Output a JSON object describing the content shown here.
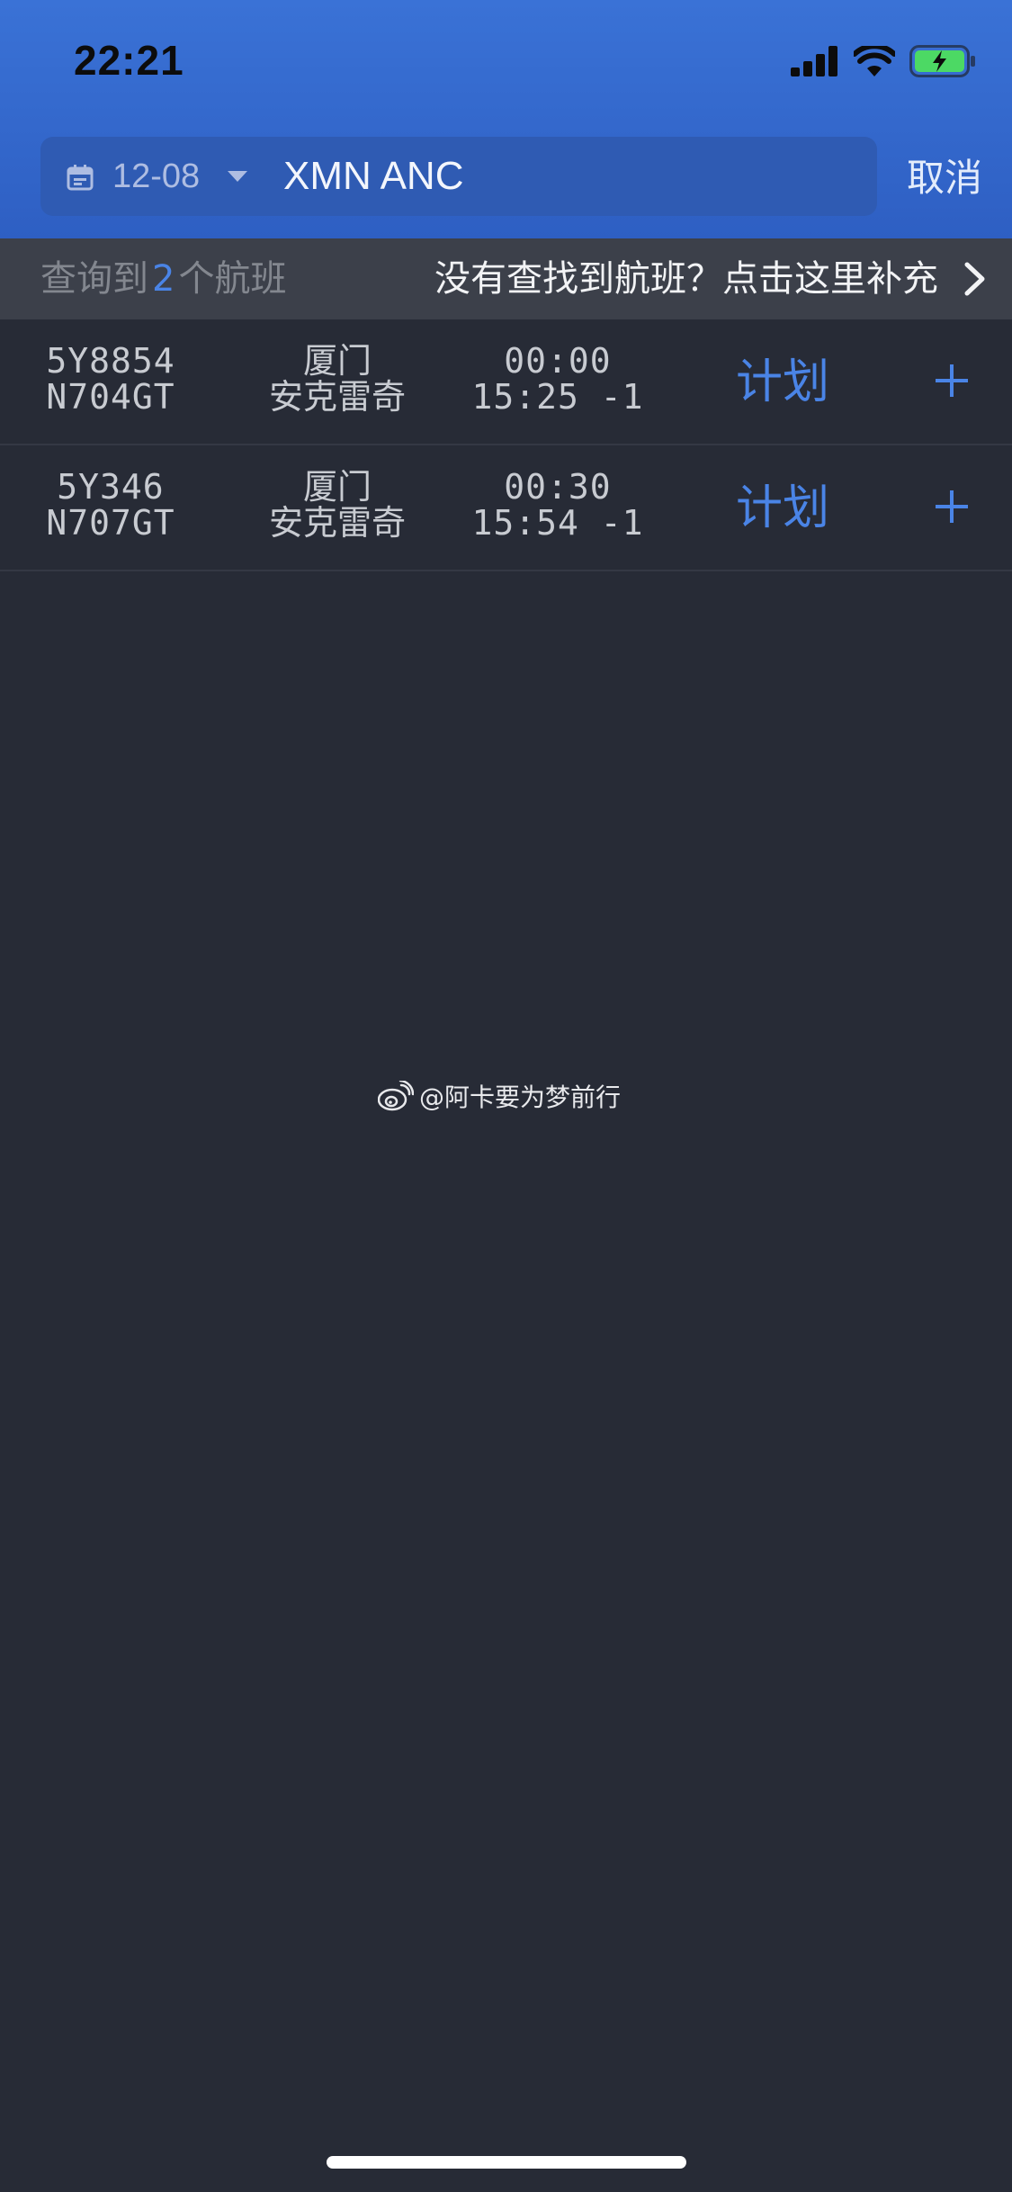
{
  "status_bar": {
    "time": "22:21"
  },
  "search": {
    "date": "12-08",
    "route": "XMN ANC",
    "cancel_label": "取消"
  },
  "info_bar": {
    "count_prefix": "查询到",
    "count": "2",
    "count_suffix": "个航班",
    "supplement_text": "没有查找到航班？点击这里补充"
  },
  "flights": [
    {
      "flight_no": "5Y8854",
      "registration": "N704GT",
      "origin": "厦门",
      "destination": "安克雷奇",
      "dep_time": "00:00",
      "arr_time": "15:25 -1",
      "plan_label": "计划"
    },
    {
      "flight_no": "5Y346",
      "registration": "N707GT",
      "origin": "厦门",
      "destination": "安克雷奇",
      "dep_time": "00:30",
      "arr_time": "15:54 -1",
      "plan_label": "计划"
    }
  ],
  "watermark": {
    "text": "@阿卡要为梦前行"
  },
  "colors": {
    "header": "#3a72d6",
    "background": "#272b36",
    "accent": "#4a84e6"
  },
  "icons": [
    "calendar-icon",
    "dropdown-arrow-icon",
    "chevron-right-icon",
    "plus-icon",
    "cellular-signal-icon",
    "wifi-icon",
    "battery-charging-icon",
    "weibo-icon"
  ]
}
